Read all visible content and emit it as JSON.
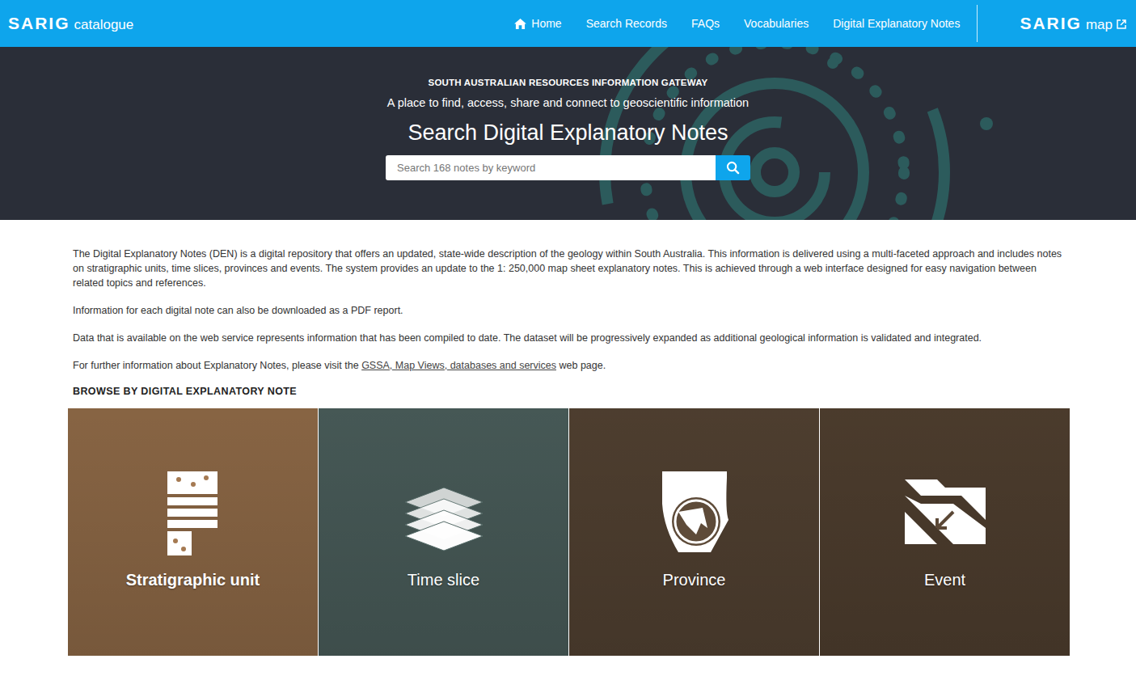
{
  "header": {
    "logo": {
      "brand": "SARIG",
      "sub": "catalogue"
    },
    "nav": [
      {
        "label": "Home",
        "kind": "home"
      },
      {
        "label": "Search Records",
        "kind": "plain"
      },
      {
        "label": "FAQs",
        "kind": "plain"
      },
      {
        "label": "Vocabularies",
        "kind": "plain"
      },
      {
        "label": "Digital Explanatory Notes",
        "kind": "plain"
      }
    ],
    "map_link": {
      "brand": "SARIG",
      "sub": "map"
    }
  },
  "hero": {
    "kicker": "SOUTH AUSTRALIAN RESOURCES INFORMATION GATEWAY",
    "tagline": "A place to find, access, share and connect to geoscientific information",
    "title": "Search Digital Explanatory Notes",
    "search": {
      "placeholder": "Search 168 notes by keyword"
    }
  },
  "intro": {
    "paragraphs": [
      "The Digital Explanatory Notes (DEN) is a digital repository that offers an updated, state-wide description of the geology within South Australia. This information is delivered using a multi-faceted approach and includes notes on stratigraphic units, time slices, provinces and events. The system provides an update to the 1: 250,000 map sheet explanatory notes. This is achieved through a web interface designed for easy navigation between related topics and references.",
      "Information for each digital note can also be downloaded as a PDF report.",
      "Data that is available on the web service represents information that has been compiled to date. The dataset will be progressively expanded as additional geological information is validated and integrated."
    ],
    "further": {
      "before": "For further information about Explanatory Notes, please visit the ",
      "link": "GSSA, Map Views, databases and services",
      "after": " web page."
    }
  },
  "browse": {
    "heading": "BROWSE BY DIGITAL EXPLANATORY NOTE",
    "tiles": [
      {
        "label": "Stratigraphic unit",
        "kind": "strata",
        "selected": true,
        "color": "#a57a52"
      },
      {
        "label": "Time slice",
        "kind": "layers",
        "selected": false,
        "color": "#556b68"
      },
      {
        "label": "Province",
        "kind": "province",
        "selected": false,
        "color": "#5e4b39"
      },
      {
        "label": "Event",
        "kind": "fault",
        "selected": false,
        "color": "#5b4836"
      }
    ]
  }
}
